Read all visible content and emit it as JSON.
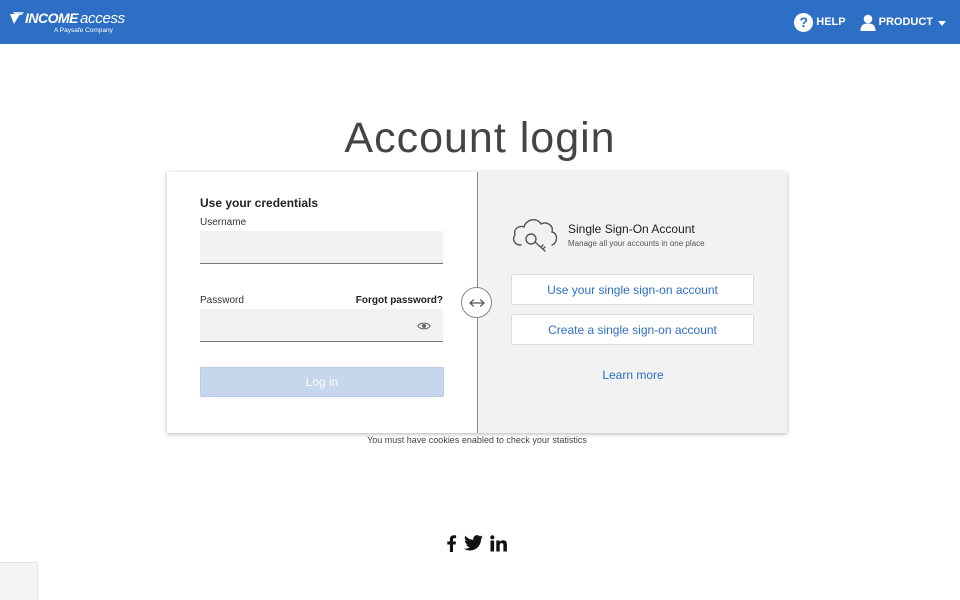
{
  "header": {
    "logo_income": "INCOME",
    "logo_access": "access",
    "logo_sub": "A Paysafe Company",
    "help_label": "HELP",
    "product_label": "PRODUCT"
  },
  "page": {
    "title": "Account login"
  },
  "credentials": {
    "title": "Use your credentials",
    "username_label": "Username",
    "username_value": "",
    "password_label": "Password",
    "password_value": "",
    "forgot_label": "Forgot password?",
    "login_label": "Log in"
  },
  "sso": {
    "title": "Single Sign-On Account",
    "subtitle": "Manage all your accounts in one place",
    "use_label": "Use your single sign-on account",
    "create_label": "Create a single sign-on account",
    "learn_more_label": "Learn more"
  },
  "footer": {
    "cookie_note": "You must have cookies enabled to check your statistics",
    "social_icons": [
      "facebook-icon",
      "twitter-icon",
      "linkedin-icon"
    ]
  },
  "colors": {
    "brand_blue": "#2d6fc4",
    "login_disabled": "#c5d6ed",
    "panel_gray": "#f2f2f2"
  }
}
